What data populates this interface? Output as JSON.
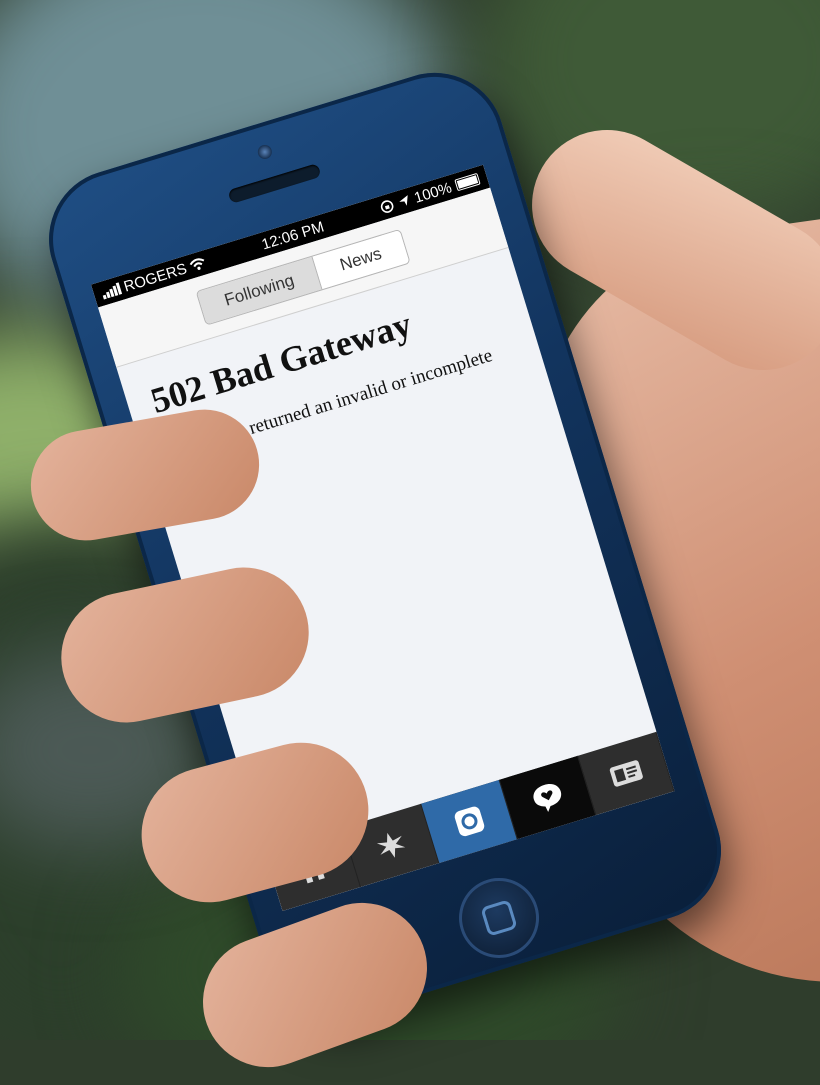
{
  "status_bar": {
    "carrier": "ROGERS",
    "time": "12:06 PM",
    "battery": "100%"
  },
  "tabs": {
    "following": "Following",
    "news": "News",
    "selected": "Following"
  },
  "error": {
    "title": "502 Bad Gateway",
    "message": "The server returned an invalid or incomplete response."
  },
  "tab_bar": {
    "items": [
      "home-icon",
      "explore-icon",
      "camera-icon",
      "news-heart-icon",
      "profile-icon"
    ],
    "active": "camera-icon"
  },
  "colors": {
    "phone_body": "#1b4577",
    "tab_active": "#2f6aa8"
  }
}
